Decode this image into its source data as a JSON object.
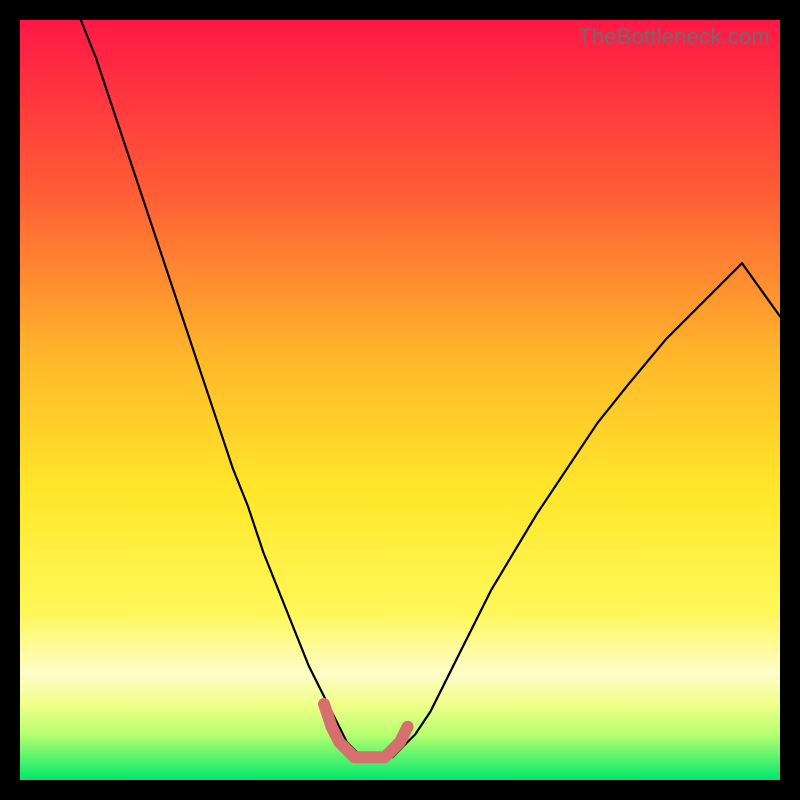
{
  "watermark": "TheBottleneck.com",
  "colors": {
    "frame_bg": "#000000",
    "gradient_top": "#ff1847",
    "gradient_mid_upper": "#ff7a2e",
    "gradient_mid": "#ffe72a",
    "gradient_mid_lower": "#fffac0",
    "gradient_lower_yellow": "#f6ff77",
    "gradient_bottom": "#00e86b",
    "curve_stroke": "#000000",
    "marker_stroke": "#d6706f"
  },
  "chart_data": {
    "type": "line",
    "title": "",
    "xlabel": "",
    "ylabel": "",
    "xlim": [
      0,
      100
    ],
    "ylim": [
      0,
      100
    ],
    "series": [
      {
        "name": "bottleneck-curve",
        "x": [
          8,
          10,
          12,
          14,
          16,
          18,
          20,
          22,
          24,
          26,
          28,
          30,
          32,
          34,
          36,
          38,
          40,
          41,
          42,
          43,
          44,
          45,
          46,
          47,
          48,
          49,
          50,
          52,
          54,
          56,
          58,
          60,
          62,
          65,
          68,
          72,
          76,
          80,
          85,
          90,
          95,
          100
        ],
        "values": [
          100,
          95,
          89,
          83,
          77,
          71,
          65,
          59,
          53,
          47,
          41,
          36,
          30,
          25,
          20,
          15,
          11,
          9,
          7,
          5,
          4,
          3,
          3,
          3,
          3,
          3,
          4,
          6,
          9,
          13,
          17,
          21,
          25,
          30,
          35,
          41,
          47,
          52,
          58,
          63,
          68,
          61
        ]
      },
      {
        "name": "optimal-range-marker",
        "x": [
          40,
          41,
          42,
          43,
          44,
          45,
          46,
          47,
          48,
          49,
          50,
          51
        ],
        "values": [
          10,
          7,
          5,
          4,
          3,
          3,
          3,
          3,
          3,
          4,
          5,
          7
        ]
      }
    ]
  }
}
